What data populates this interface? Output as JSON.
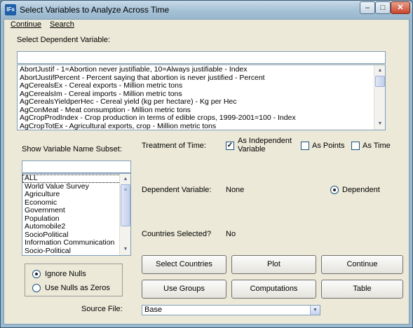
{
  "window": {
    "title": "Select Variables to Analyze Across Time",
    "app_icon_text": "IFs"
  },
  "menu": [
    {
      "label": "Continue"
    },
    {
      "label": "Search"
    }
  ],
  "dependent": {
    "heading": "Select Dependent Variable:",
    "search_value": "",
    "items": [
      "AbortJustif - 1=Abortion never justifiable, 10=Always justifiable - Index",
      "AbortJustifPercent - Percent saying that abortion is never justified - Percent",
      "AgCerealsEx - Cereal exports - Million metric tons",
      "AgCerealsIm - Cereal imports - Million metric tons",
      "AgCerealsYieldperHec - Cereal yield (kg per hectare) - Kg per Hec",
      "AgConMeat - Meat consumption - Million metric tons",
      "AgCropProdIndex - Crop production in terms of edible crops, 1999-2001=100 - Index",
      "AgCropTotEx - Agricultural exports, crop - Million metric tons"
    ]
  },
  "subset": {
    "heading": "Show Variable Name Subset:",
    "search_value": "",
    "items": [
      "ALL",
      "World Value Survey",
      "Agriculture",
      "Economic",
      "Government",
      "Population",
      "Automobile2",
      "SocioPolitical",
      "Information Communication",
      "Socio-Political"
    ]
  },
  "nulls": {
    "ignore_label": "Ignore Nulls",
    "use_zero_label": "Use Nulls as Zeros",
    "selected": "ignore"
  },
  "time": {
    "label": "Treatment of Time:",
    "independent_label_line1": "As Independent",
    "independent_label_line2": "Variable",
    "independent_checked": true,
    "points_label": "As Points",
    "points_checked": false,
    "time_label": "As Time",
    "time_checked": false
  },
  "dependent_variable": {
    "label": "Dependent Variable:",
    "value": "None",
    "radio_label": "Dependent",
    "radio_selected": true
  },
  "countries": {
    "label": "Countries Selected?",
    "value": "No"
  },
  "buttons": {
    "select_countries": "Select Countries",
    "plot": "Plot",
    "continue": "Continue",
    "use_groups": "Use Groups",
    "computations": "Computations",
    "table": "Table"
  },
  "source": {
    "label": "Source File:",
    "value": "Base"
  },
  "colors": {
    "client_bg": "#ece9d8",
    "title_bar": "#a5c1d6",
    "close_button": "#c9462c"
  }
}
